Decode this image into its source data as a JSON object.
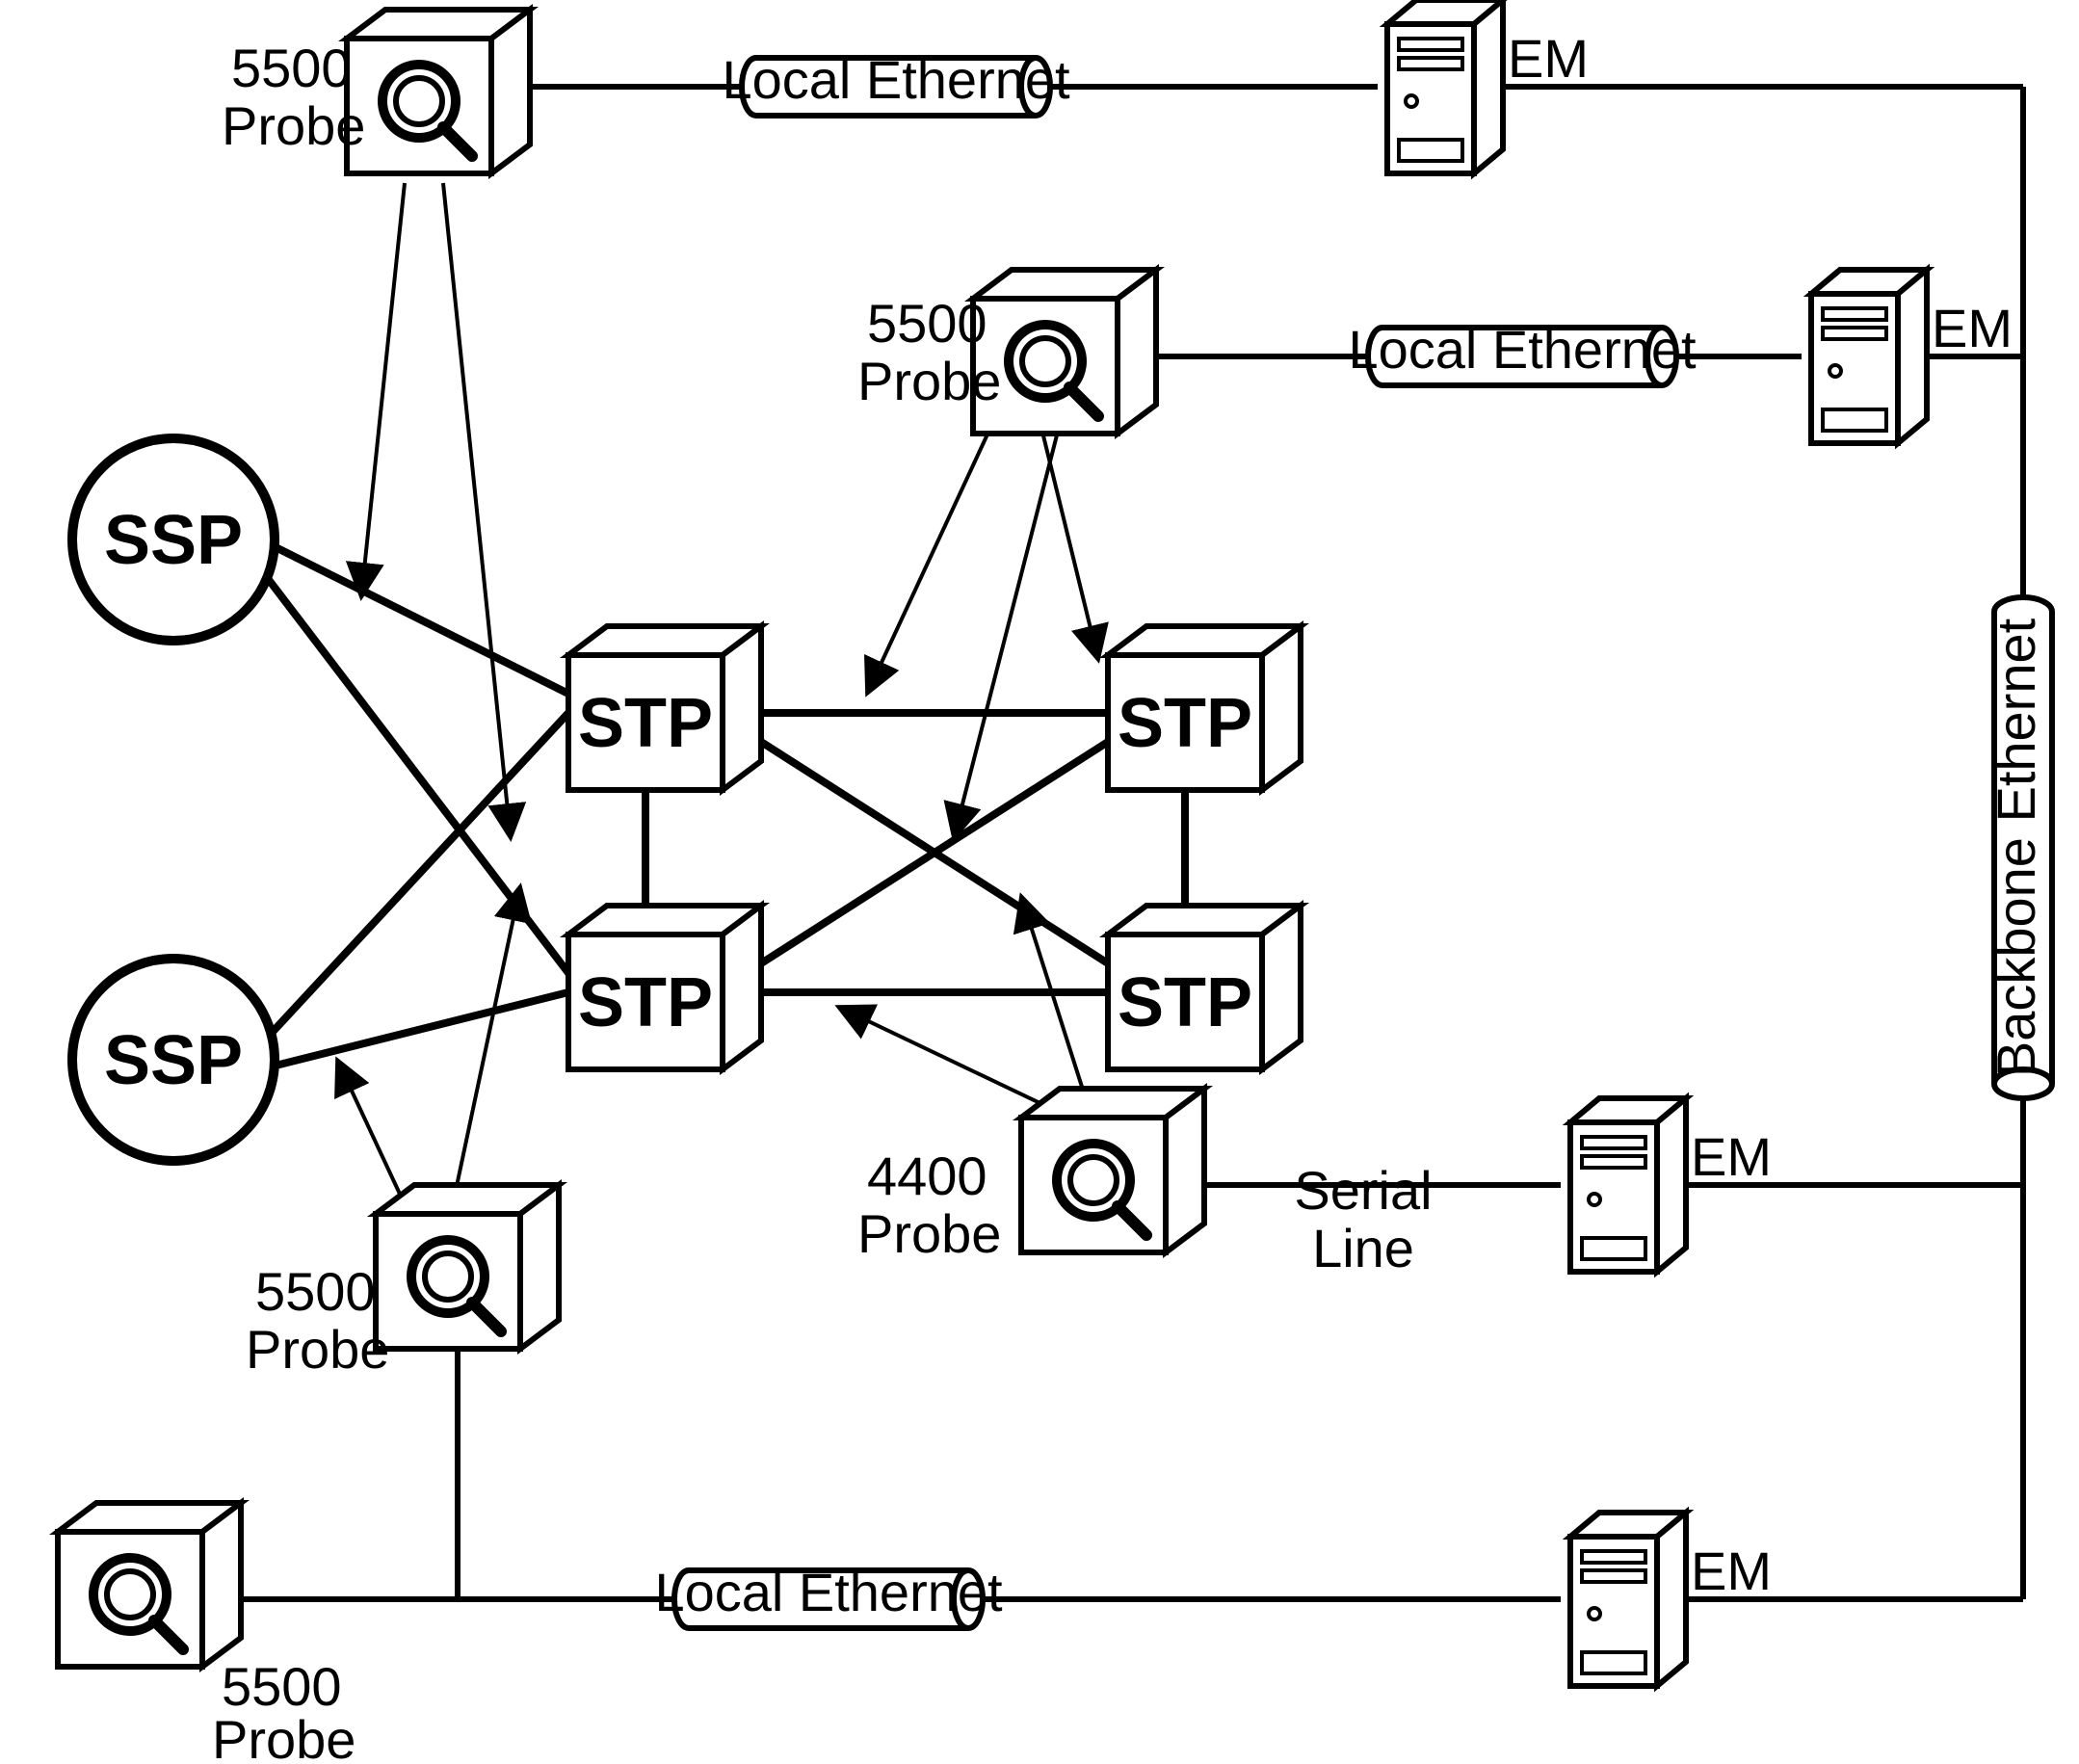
{
  "nodes": {
    "ssp": {
      "label": "SSP"
    },
    "stp": {
      "label": "STP"
    },
    "em": {
      "label": "EM"
    }
  },
  "probes": {
    "p5500": {
      "line1": "5500",
      "line2": "Probe"
    },
    "p4400": {
      "line1": "4400",
      "line2": "Probe"
    }
  },
  "links": {
    "localEthernet": "Local Ethernet",
    "serial1": "Serial",
    "serial2": "Line",
    "backboneEthernet": "Backbone Ethernet"
  }
}
